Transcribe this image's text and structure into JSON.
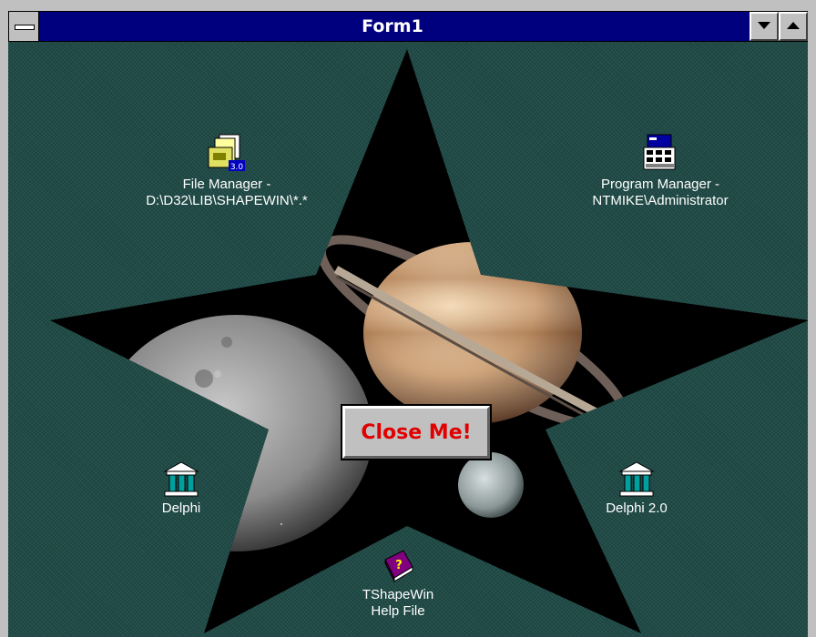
{
  "window": {
    "title": "Form1"
  },
  "desktop_icons": [
    {
      "id": "file-manager",
      "line1": "File Manager -",
      "line2": "D:\\D32\\LIB\\SHAPEWIN\\*.*"
    },
    {
      "id": "program-manager",
      "line1": "Program Manager -",
      "line2": "NTMIKE\\Administrator"
    },
    {
      "id": "delphi",
      "line1": "Delphi",
      "line2": ""
    },
    {
      "id": "delphi-2",
      "line1": "Delphi 2.0",
      "line2": ""
    },
    {
      "id": "tshapewin-help",
      "line1": "TShapeWin",
      "line2": "Help File"
    }
  ],
  "close_button": {
    "label": "Close Me!",
    "text_color": "#e00000"
  },
  "colors": {
    "titlebar": "#00007f",
    "desktop": "#1f4a46",
    "star_fill": "#000000"
  }
}
